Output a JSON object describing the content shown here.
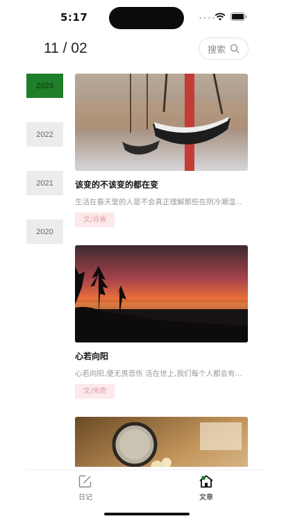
{
  "status_bar": {
    "time": "5:17",
    "signal_dots": "••••"
  },
  "header": {
    "date": "11 / 02",
    "search_label": "搜索"
  },
  "years": [
    {
      "label": "2023",
      "active": true
    },
    {
      "label": "2022",
      "active": false
    },
    {
      "label": "2021",
      "active": false
    },
    {
      "label": "2020",
      "active": false
    }
  ],
  "articles": [
    {
      "title": "该变的不该变的都在变",
      "excerpt": "生活在春天里的人是不会真正理解那些在阴冷潮湿...",
      "author": "文/肖睿",
      "image": "swings-photo"
    },
    {
      "title": "心若向阳",
      "excerpt": "心若向阳,便无畏悲伤 活在世上,我们每个人都会有...",
      "author": "文/宋奇",
      "image": "sunset-lake-photo"
    },
    {
      "title": "",
      "excerpt": "",
      "author": "",
      "image": "flowers-magnifier-photo"
    }
  ],
  "tabs": {
    "diary": "日记",
    "article": "文章"
  },
  "colors": {
    "active_year": "#1e7e29",
    "tag_bg": "#fde8ea",
    "tag_text": "#e2a0a8"
  }
}
